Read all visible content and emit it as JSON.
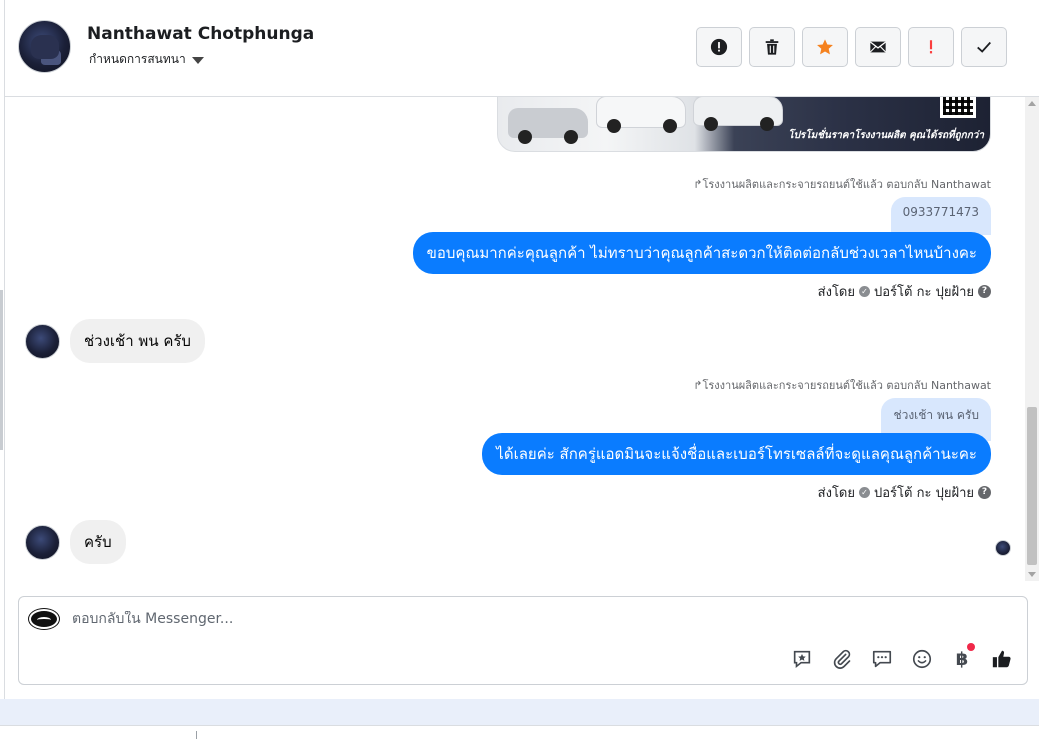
{
  "header": {
    "name": "Nanthawat Chotphunga",
    "assign_label": "กำหนดการสนทนา"
  },
  "promo_image": {
    "caption": "โปรโมชั่นราคาโรงงานผลิต คุณได้รถที่ถูกกว่า"
  },
  "messages": {
    "reply1_meta": "โรงงานผลิตและกระจายรถยนต์ใช้แล้ว ตอบกลับ Nanthawat",
    "quote1": "0933771473",
    "out1": "ขอบคุณมากค่ะคุณลูกค้า ไม่ทราบว่าคุณลูกค้าสะดวกให้ติดต่อกลับช่วงเวลาไหนบ้างคะ",
    "sent_by_prefix": "ส่งโดย",
    "sender_name": "ปอร์โต้ กะ ปุยฝ้าย",
    "in1": "ช่วงเช้า พน ครับ",
    "reply2_meta": "โรงงานผลิตและกระจายรถยนต์ใช้แล้ว ตอบกลับ Nanthawat",
    "quote2": "ช่วงเช้า พน ครับ",
    "out2": "ได้เลยค่ะ สักครู่แอดมินจะแจ้งชื่อและเบอร์โทรเซลล์ที่จะดูแลคุณลูกค้านะคะ",
    "in2": "ครับ"
  },
  "composer": {
    "placeholder": "ตอบกลับใน Messenger..."
  },
  "icons": {
    "baht_symbol": "฿"
  },
  "colors": {
    "outgoing_bubble": "#0a7cff",
    "incoming_bubble": "#f0f0f0",
    "quote_bg": "#d8e7fd",
    "star": "#f5821f",
    "spam": "#fa3e3e"
  }
}
